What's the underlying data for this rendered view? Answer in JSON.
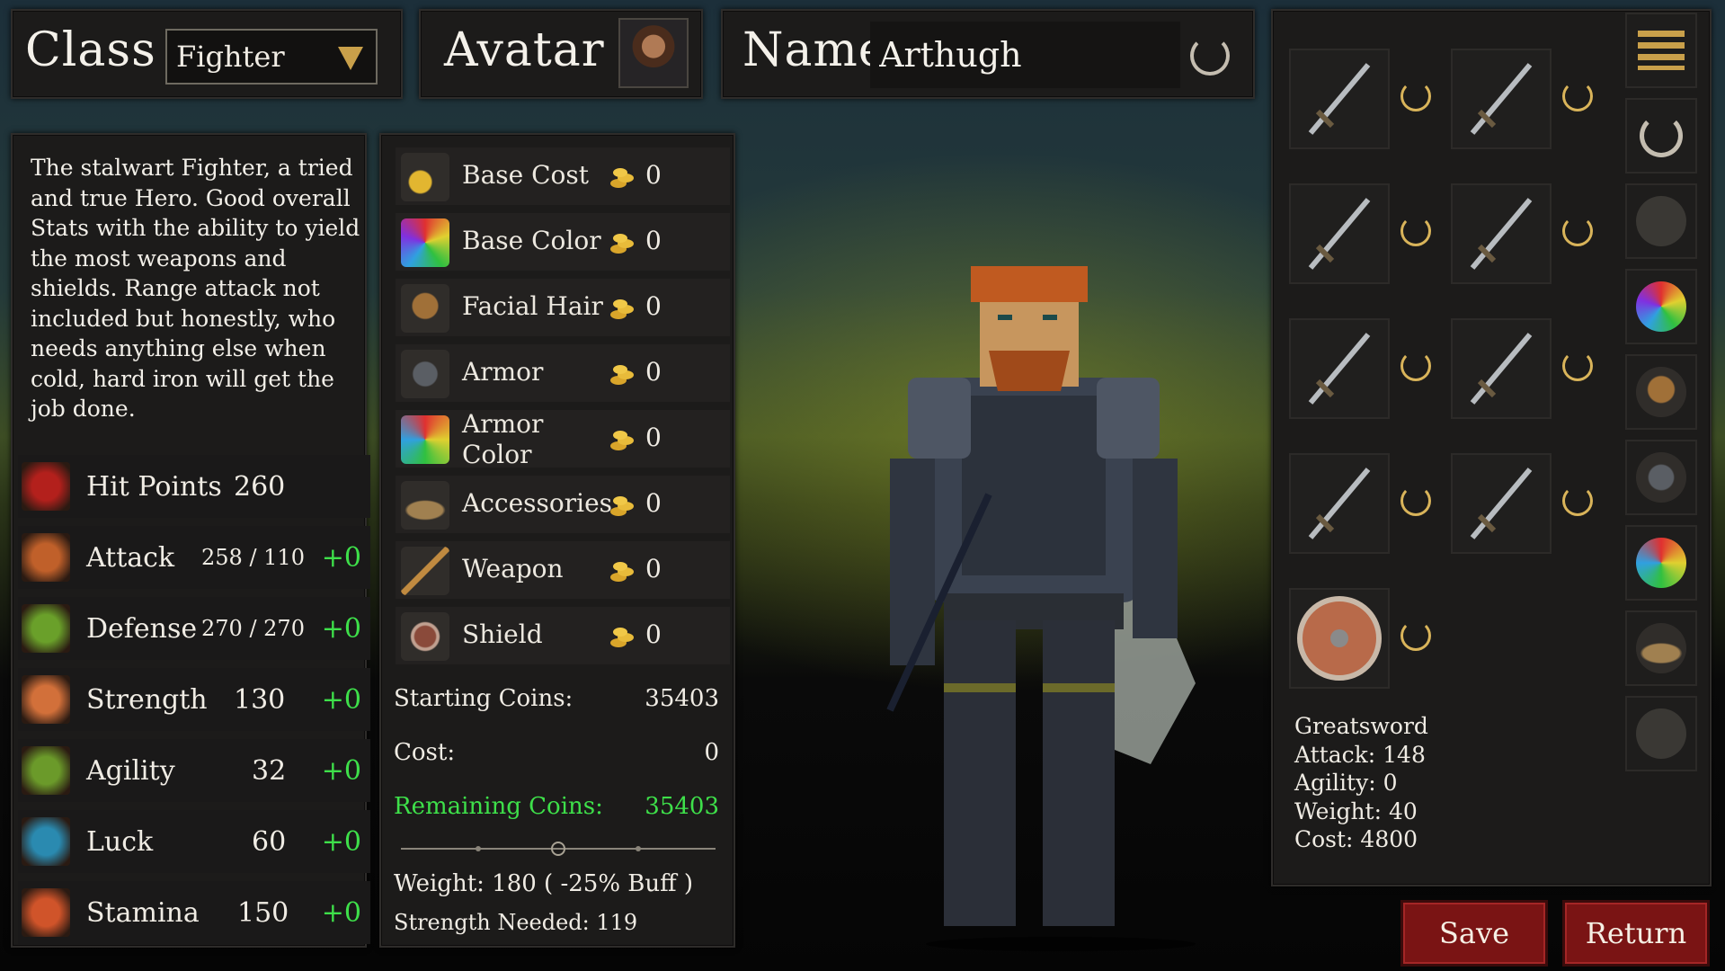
{
  "header": {
    "class_label": "Class",
    "class_value": "Fighter",
    "avatar_label": "Avatar",
    "name_label": "Name",
    "name_value": "Arthugh"
  },
  "description": "The stalwart Fighter, a tried and true Hero. Good overall Stats with the ability to yield the most weapons and shields. Range attack not included but honestly, who needs anything else when cold, hard iron will get the job done.",
  "stats": [
    {
      "name": "Hit Points",
      "value": "260",
      "bonus": "",
      "icon": "heart-icon",
      "color": "#b3201c"
    },
    {
      "name": "Attack",
      "value": "258 / 110",
      "bonus": "+0",
      "icon": "sword-fist-icon",
      "color": "#c0602a"
    },
    {
      "name": "Defense",
      "value": "270 / 270",
      "bonus": "+0",
      "icon": "shield-swirl-icon",
      "color": "#6aa02a"
    },
    {
      "name": "Strength",
      "value": "130",
      "bonus": "+0",
      "icon": "fist-icon",
      "color": "#d2703a"
    },
    {
      "name": "Agility",
      "value": "32",
      "bonus": "+0",
      "icon": "boot-icon",
      "color": "#6b9a2a"
    },
    {
      "name": "Luck",
      "value": "60",
      "bonus": "+0",
      "icon": "horseshoe-icon",
      "color": "#2a8ab0"
    },
    {
      "name": "Stamina",
      "value": "150",
      "bonus": "+0",
      "icon": "burst-icon",
      "color": "#d0542a"
    }
  ],
  "costs": [
    {
      "label": "Base Cost",
      "value": "0",
      "icon": "coins-icon"
    },
    {
      "label": "Base Color",
      "value": "0",
      "icon": "color-wheel-icon"
    },
    {
      "label": "Facial Hair",
      "value": "0",
      "icon": "beard-icon"
    },
    {
      "label": "Armor",
      "value": "0",
      "icon": "armor-icon"
    },
    {
      "label": "Armor\nColor",
      "value": "0",
      "icon": "armor-color-icon"
    },
    {
      "label": "Accessories",
      "value": "0",
      "icon": "hat-icon"
    },
    {
      "label": "Weapon",
      "value": "0",
      "icon": "weapon-icon"
    },
    {
      "label": "Shield",
      "value": "0",
      "icon": "shield-icon"
    }
  ],
  "summary": {
    "starting_label": "Starting Coins:",
    "starting_value": "35403",
    "cost_label": "Cost:",
    "cost_value": "0",
    "remaining_label": "Remaining Coins:",
    "remaining_value": "35403",
    "weight": "Weight: 180 ( -25% Buff )",
    "strength_needed": "Strength Needed: 119"
  },
  "weapons": [
    {
      "icon": "sword-icon"
    },
    {
      "icon": "longsword-icon"
    },
    {
      "icon": "ornate-sword-icon"
    },
    {
      "icon": "battle-axe-icon"
    },
    {
      "icon": "halberd-icon"
    },
    {
      "icon": "mace-icon"
    },
    {
      "icon": "hammer-icon"
    },
    {
      "icon": "warhammer-icon"
    },
    {
      "icon": "round-shield-icon"
    }
  ],
  "side_buttons": [
    {
      "icon": "menu-icon"
    },
    {
      "icon": "reset-icon"
    },
    {
      "icon": "body-icon"
    },
    {
      "icon": "color-wheel-icon"
    },
    {
      "icon": "beard-icon"
    },
    {
      "icon": "armor-icon"
    },
    {
      "icon": "armor-color-icon"
    },
    {
      "icon": "hat-icon"
    },
    {
      "icon": "crest-shield-icon"
    }
  ],
  "item_info": {
    "name": "Greatsword",
    "attack": "Attack: 148",
    "agility": "Agility: 0",
    "weight": "Weight: 40",
    "cost": "Cost: 4800"
  },
  "buttons": {
    "save": "Save",
    "return": "Return"
  },
  "colors": {
    "bonus": "#3ee04a",
    "button": "#7a1414",
    "accent": "#c9a04a"
  }
}
